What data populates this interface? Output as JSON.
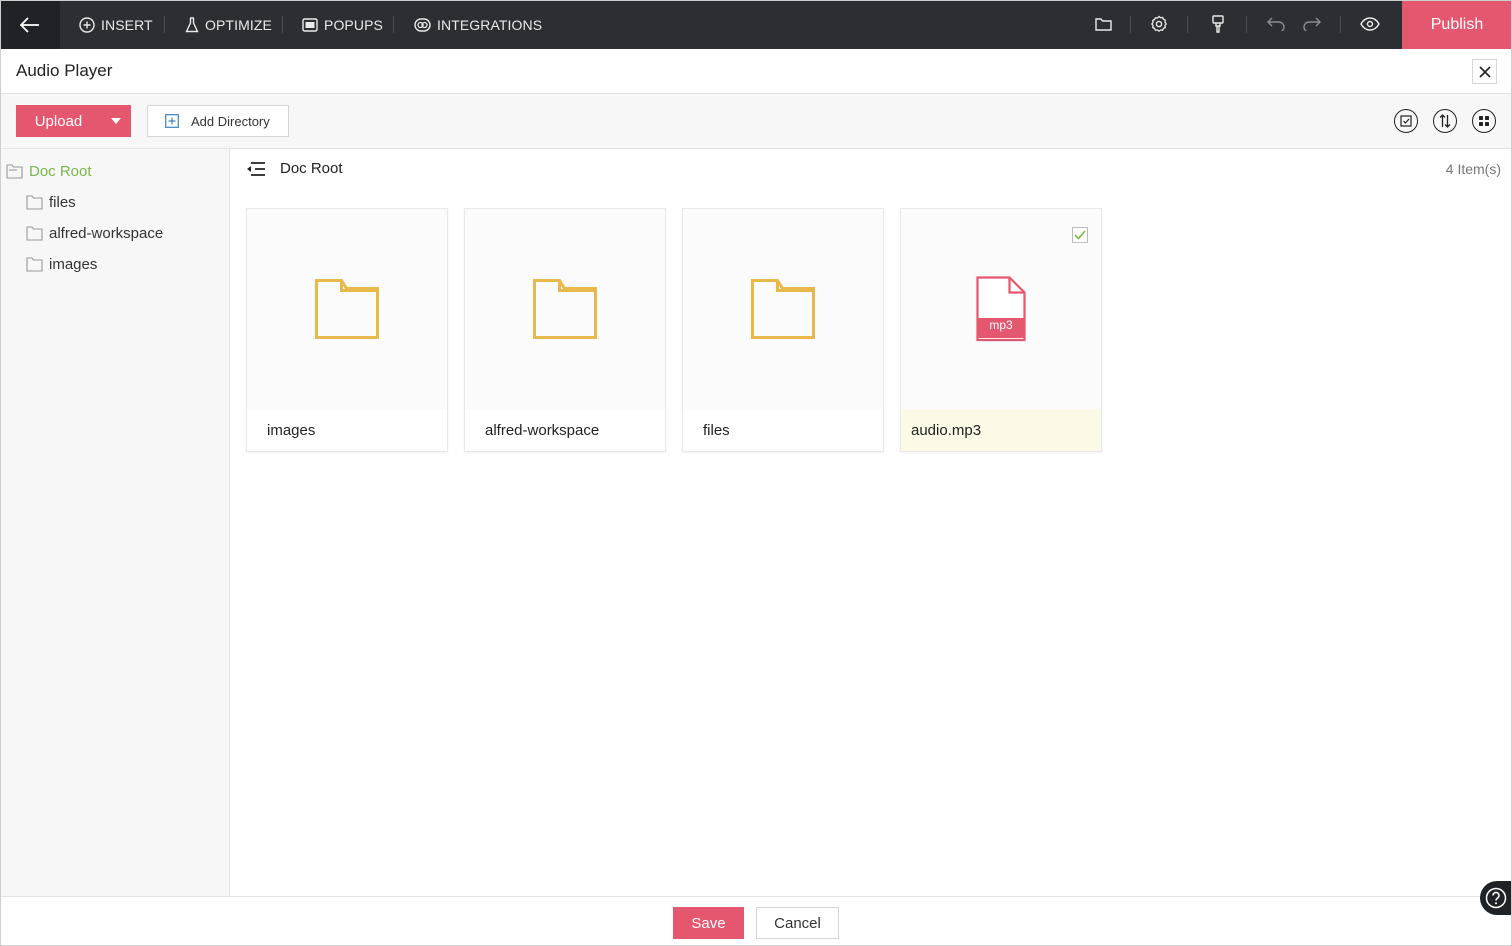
{
  "topbar": {
    "nav": [
      {
        "label": "INSERT",
        "icon": "plus-circle-icon"
      },
      {
        "label": "OPTIMIZE",
        "icon": "flask-icon"
      },
      {
        "label": "POPUPS",
        "icon": "popup-window-icon"
      },
      {
        "label": "INTEGRATIONS",
        "icon": "integrations-icon"
      }
    ],
    "publish_label": "Publish"
  },
  "dialog": {
    "title": "Audio Player"
  },
  "toolbar": {
    "upload_label": "Upload",
    "add_directory_label": "Add Directory"
  },
  "sidebar": {
    "root_label": "Doc Root",
    "items": [
      {
        "label": "files"
      },
      {
        "label": "alfred-workspace"
      },
      {
        "label": "images"
      }
    ]
  },
  "main": {
    "current_folder": "Doc Root",
    "item_count": "4 Item(s)",
    "items": [
      {
        "name": "images",
        "type": "folder"
      },
      {
        "name": "alfred-workspace",
        "type": "folder"
      },
      {
        "name": "files",
        "type": "folder"
      },
      {
        "name": "audio.mp3",
        "type": "file",
        "ext": "mp3",
        "selected": true
      }
    ]
  },
  "footer": {
    "save_label": "Save",
    "cancel_label": "Cancel"
  },
  "colors": {
    "accent": "#e5566f",
    "folder": "#e8b84a",
    "tree_root": "#7ab648",
    "topbar": "#2b2e33"
  }
}
